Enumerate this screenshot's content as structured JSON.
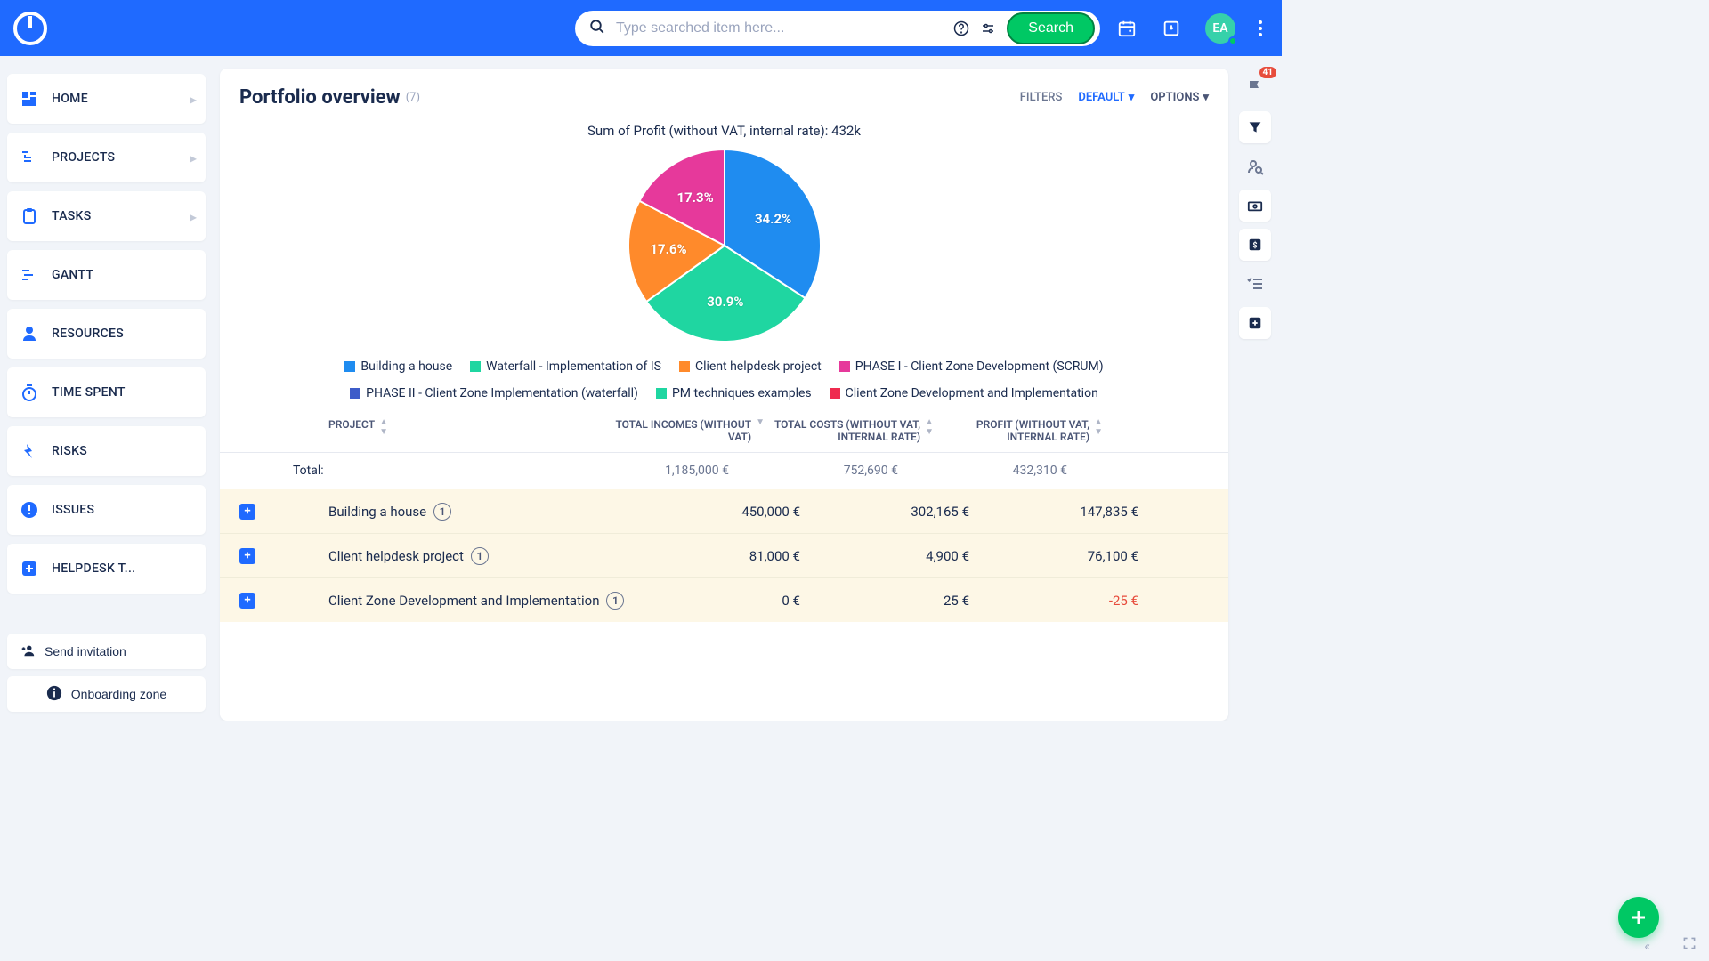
{
  "topbar": {
    "search_placeholder": "Type searched item here...",
    "search_button": "Search",
    "avatar_initials": "EA"
  },
  "sidebar": {
    "items": [
      {
        "label": "HOME",
        "chevron": true
      },
      {
        "label": "PROJECTS",
        "chevron": true
      },
      {
        "label": "TASKS",
        "chevron": true
      },
      {
        "label": "GANTT",
        "chevron": false
      },
      {
        "label": "RESOURCES",
        "chevron": false
      },
      {
        "label": "TIME SPENT",
        "chevron": false
      },
      {
        "label": "RISKS",
        "chevron": false
      },
      {
        "label": "ISSUES",
        "chevron": false
      },
      {
        "label": "HELPDESK T...",
        "chevron": false
      }
    ],
    "invite_label": "Send invitation",
    "onboard_label": "Onboarding zone"
  },
  "header": {
    "title": "Portfolio overview",
    "count": "(7)",
    "filters_label": "FILTERS",
    "filters_value": "DEFAULT",
    "options_label": "OPTIONS"
  },
  "chart": {
    "title": "Sum of Profit (without VAT, internal rate): 432k"
  },
  "chart_data": {
    "type": "pie",
    "title": "Sum of Profit (without VAT, internal rate): 432k",
    "series": [
      {
        "name": "Building a house",
        "value": 34.2,
        "color": "#1f8cf0",
        "label": "34.2%"
      },
      {
        "name": "Waterfall - Implementation of IS",
        "value": 30.9,
        "color": "#1fd6a1",
        "label": "30.9%"
      },
      {
        "name": "Client helpdesk project",
        "value": 17.6,
        "color": "#ff8a2b",
        "label": "17.6%"
      },
      {
        "name": "PHASE I - Client Zone Development (SCRUM)",
        "value": 17.3,
        "color": "#e6399b",
        "label": "17.3%"
      },
      {
        "name": "PHASE II - Client Zone Implementation (waterfall)",
        "value": 0,
        "color": "#3e5cc9",
        "label": ""
      },
      {
        "name": "PM techniques examples",
        "value": 0,
        "color": "#1fd6a1",
        "label": ""
      },
      {
        "name": "Client Zone Development and Implementation",
        "value": 0,
        "color": "#ef2b4f",
        "label": ""
      }
    ]
  },
  "table": {
    "columns": {
      "project": "PROJECT",
      "incomes": "TOTAL INCOMES (WITHOUT VAT)",
      "costs": "TOTAL COSTS (WITHOUT VAT, INTERNAL RATE)",
      "profit": "PROFIT (WITHOUT VAT, INTERNAL RATE)"
    },
    "total_label": "Total:",
    "totals": {
      "incomes": "1,185,000 €",
      "costs": "752,690 €",
      "profit": "432,310 €"
    },
    "rows": [
      {
        "name": "Building a house",
        "badge": "1",
        "incomes": "450,000 €",
        "costs": "302,165 €",
        "profit": "147,835 €",
        "neg": false
      },
      {
        "name": "Client helpdesk project",
        "badge": "1",
        "incomes": "81,000 €",
        "costs": "4,900 €",
        "profit": "76,100 €",
        "neg": false
      },
      {
        "name": "Client Zone Development and Implementation",
        "badge": "1",
        "incomes": "0 €",
        "costs": "25 €",
        "profit": "-25 €",
        "neg": true
      }
    ]
  },
  "rail": {
    "flag_badge": "41"
  }
}
